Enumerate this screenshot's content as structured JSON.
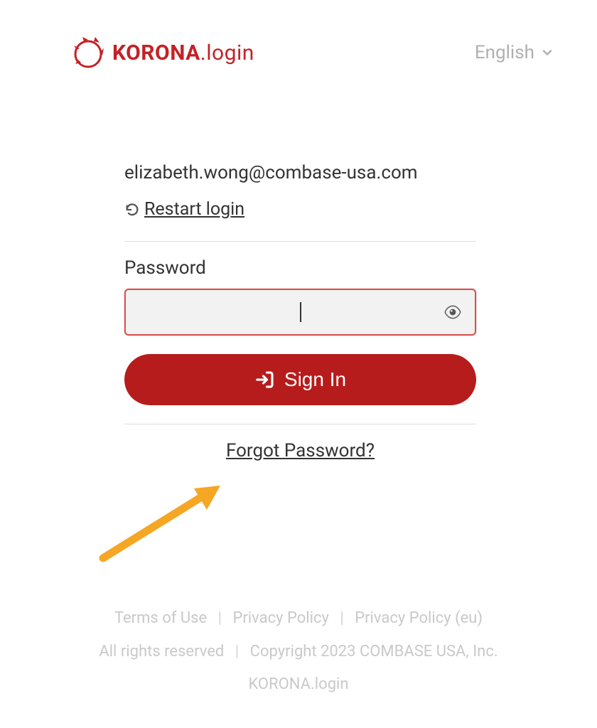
{
  "header": {
    "logo_bold": "KORONA",
    "logo_light": ".login",
    "language": "English"
  },
  "main": {
    "email": "elizabeth.wong@combase-usa.com",
    "restart_label": "Restart login",
    "password_label": "Password",
    "signin_label": "Sign In",
    "forgot_label": "Forgot Password?"
  },
  "footer": {
    "terms": "Terms of Use",
    "privacy": "Privacy Policy",
    "privacy_eu": "Privacy Policy (eu)",
    "rights": "All rights reserved",
    "copyright": "Copyright 2023 COMBASE USA, Inc.",
    "product": "KORONA.login"
  },
  "colors": {
    "brand": "#c42126",
    "button": "#b71c1c",
    "annotation": "#f5a623"
  }
}
